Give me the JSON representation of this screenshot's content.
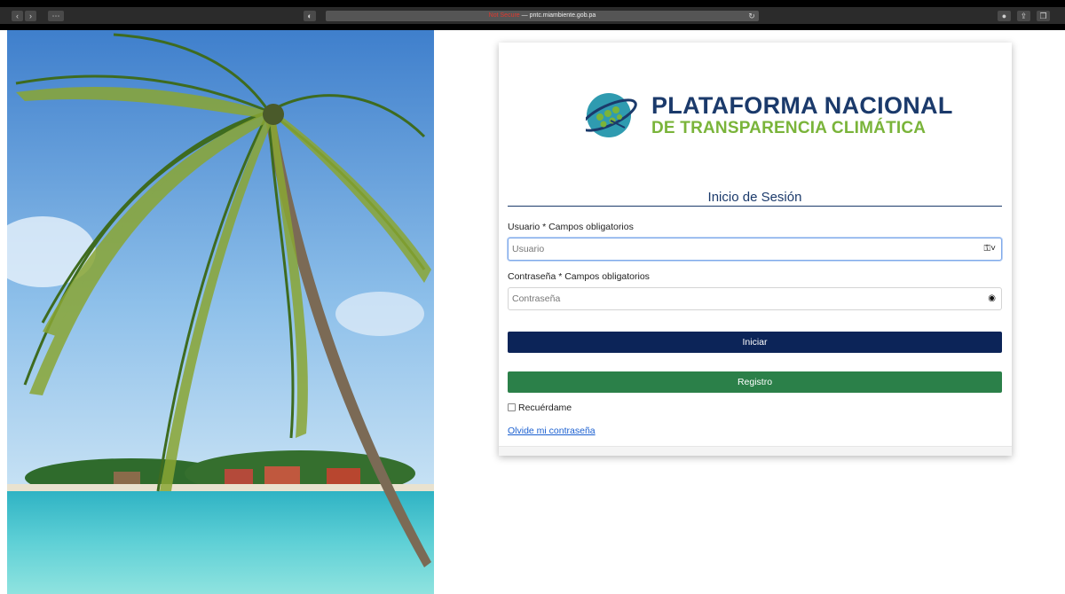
{
  "browser": {
    "url_prefix": "Not Secure",
    "url_host": "— pntc.miambiente.gob.pa"
  },
  "logo": {
    "line1": "PLATAFORMA NACIONAL",
    "line2": "DE TRANSPARENCIA CLIMÁTICA"
  },
  "form": {
    "title": "Inicio de Sesión",
    "username_label": "Usuario * Campos obligatorios",
    "username_placeholder": "Usuario",
    "password_label": "Contraseña * Campos obligatorios",
    "password_placeholder": "Contraseña",
    "login_button": "Iniciar",
    "register_button": "Registro",
    "remember_label": "Recuérdame",
    "forgot_link": "Olvide mi contraseña"
  },
  "colors": {
    "primary": "#0c2458",
    "success": "#2b8049",
    "logo_blue": "#1b3a6b",
    "logo_green": "#7ab43a"
  }
}
